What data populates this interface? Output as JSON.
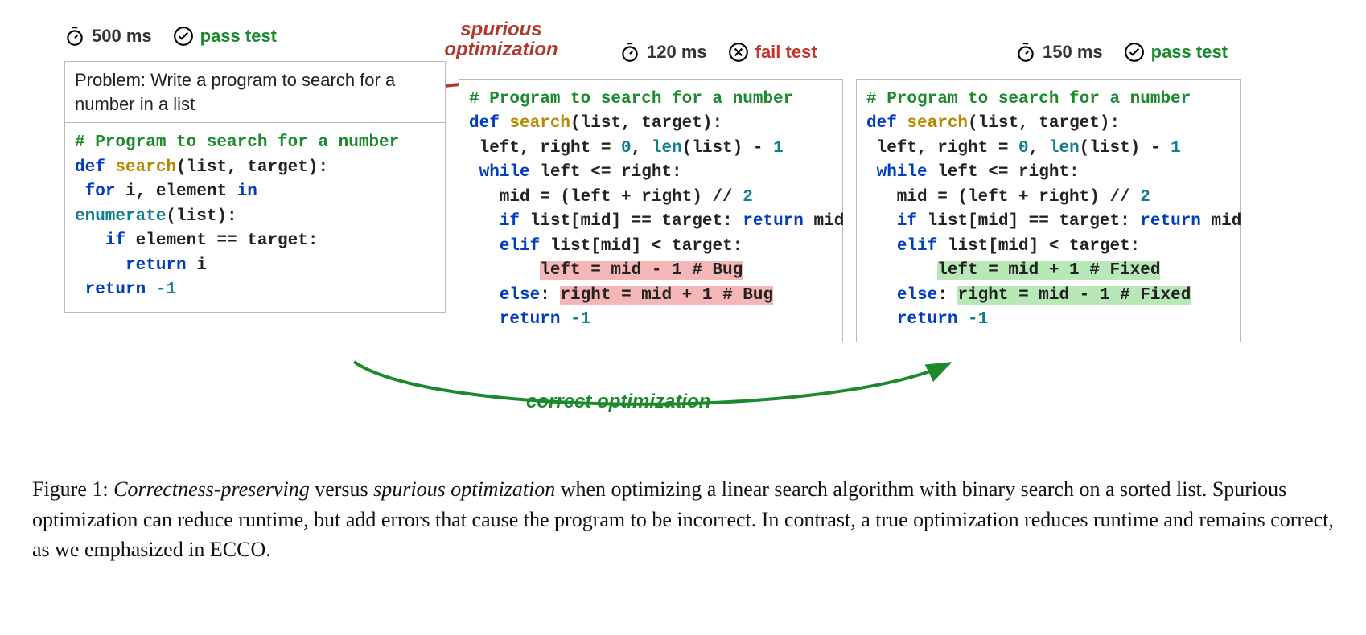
{
  "badges": {
    "left": {
      "time": "500 ms",
      "status": "pass test"
    },
    "mid": {
      "time": "120 ms",
      "status": "fail test"
    },
    "right": {
      "time": "150 ms",
      "status": "pass test"
    }
  },
  "labels": {
    "spurious_line1": "spurious",
    "spurious_line2": "optimization",
    "correct": "correct optimization"
  },
  "problem": {
    "text": "Problem: Write a program to search for a number in a list"
  },
  "code_left": {
    "comment": "# Program to search for a number",
    "def_kw": "def",
    "fn": "search",
    "sig": "(list, target):",
    "for_kw": "for",
    "for_rest": " i, element ",
    "in_kw": "in",
    "enum": "enumerate",
    "enum_rest": "(list):",
    "if_kw": "if",
    "if_rest": " element == target:",
    "return_kw": "return",
    "return_i": " i",
    "return_kw2": "return",
    "neg1": " -1"
  },
  "code_mid": {
    "comment": "# Program to search for a number",
    "def_kw": "def",
    "fn": "search",
    "sig": "(list, target):",
    "lr": " left, right = ",
    "zero": "0",
    "comma": ", ",
    "len": "len",
    "len_rest": "(list) - ",
    "one": "1",
    "while_kw": "while",
    "while_rest": " left <= right:",
    "mid_line": "   mid = (left + right) // ",
    "two": "2",
    "if_kw": "if",
    "if_rest": " list[mid] == target: ",
    "return_kw": "return",
    "return_mid": " mid",
    "elif_kw": "elif",
    "elif_rest": " list[mid] < target:",
    "bug1_pre": "       ",
    "bug1": "left = mid - 1 # Bug",
    "else_kw": "else",
    "else_colon": ": ",
    "bug2": "right = mid + 1 # Bug",
    "return_kw2": "return",
    "neg1": " -1"
  },
  "code_right": {
    "comment": "# Program to search for a number",
    "def_kw": "def",
    "fn": "search",
    "sig": "(list, target):",
    "lr": " left, right = ",
    "zero": "0",
    "comma": ", ",
    "len": "len",
    "len_rest": "(list) - ",
    "one": "1",
    "while_kw": "while",
    "while_rest": " left <= right:",
    "mid_line": "   mid = (left + right) // ",
    "two": "2",
    "if_kw": "if",
    "if_rest": " list[mid] == target: ",
    "return_kw": "return",
    "return_mid": " mid",
    "elif_kw": "elif",
    "elif_rest": " list[mid] < target:",
    "fix1_pre": "       ",
    "fix1": "left = mid + 1 # Fixed",
    "else_kw": "else",
    "else_colon": ": ",
    "fix2": "right = mid - 1 # Fixed",
    "return_kw2": "return",
    "neg1": " -1"
  },
  "caption": {
    "label": "Figure 1: ",
    "em1": "Correctness-preserving",
    "mid1": " versus ",
    "em2": "spurious optimization",
    "rest": " when optimizing a linear search algorithm with binary search on a sorted list. Spurious optimization can reduce runtime, but add errors that cause the program to be incorrect. In contrast, a true optimization reduces runtime and remains correct, as we emphasized in ECCO."
  }
}
